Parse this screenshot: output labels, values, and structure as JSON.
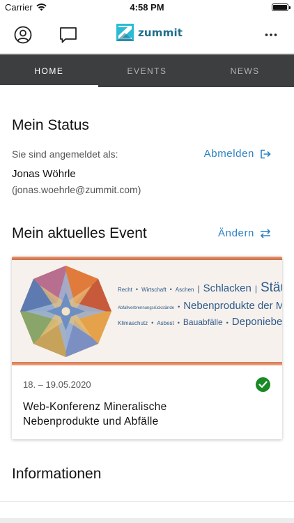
{
  "status_bar": {
    "carrier": "Carrier",
    "time": "4:58 PM"
  },
  "header": {
    "logo_text": "zummit"
  },
  "tabs": [
    {
      "label": "HOME",
      "active": true
    },
    {
      "label": "EVENTS",
      "active": false
    },
    {
      "label": "NEWS",
      "active": false
    }
  ],
  "status": {
    "title": "Mein Status",
    "logged_in_label": "Sie sind angemeldet als:",
    "logout_label": "Abmelden",
    "user_name": "Jonas Wöhrle",
    "user_email": "(jonas.woehrle@zummit.com)"
  },
  "event": {
    "title": "Mein aktuelles Event",
    "change_label": "Ändern",
    "date": "18. – 19.05.2020",
    "name": "Web-Konferenz Mineralische Nebenprodukte und Abfälle",
    "banner": {
      "row1": [
        "Recht",
        "Wirtschaft",
        "Aschen",
        "Schlacken",
        "Stäube"
      ],
      "row2": [
        "Abfallverbrennungsrückstände",
        "Nebenprodukte der Metallurgie"
      ],
      "row3": [
        "Klimaschutz",
        "Asbest",
        "Bauabfälle",
        "Deponiebedarf"
      ]
    }
  },
  "info": {
    "title": "Informationen"
  },
  "colors": {
    "accent": "#2a82c4",
    "tabbar": "#3d3e40",
    "check": "#1a8a24",
    "logo": "#1e6e8c"
  },
  "icons": [
    "wifi-icon",
    "battery-icon",
    "profile-icon",
    "chat-icon",
    "more-icon",
    "logout-icon",
    "swap-icon",
    "check-icon"
  ]
}
